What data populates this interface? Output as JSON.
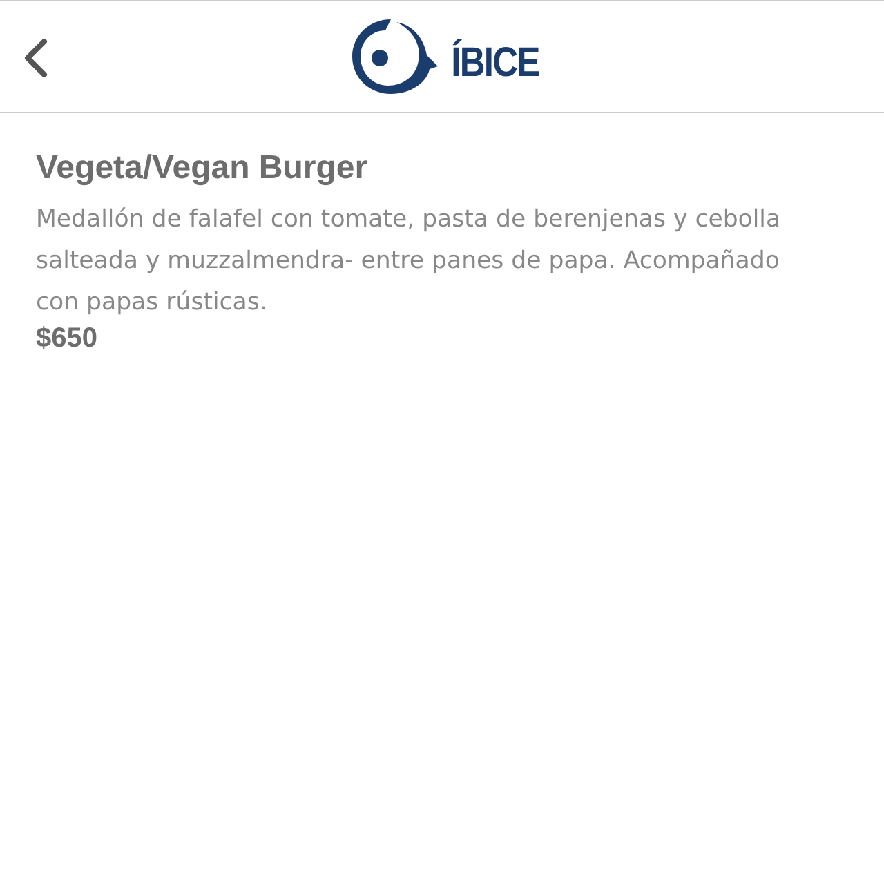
{
  "header": {
    "logo_text": "ÍBICE"
  },
  "item": {
    "title": "Vegeta/Vegan Burger",
    "description": "Medallón de falafel con tomate, pasta de berenjenas y cebolla salteada y muzzalmendra- entre panes de papa. Acompañado con papas rústicas.",
    "price": "$650"
  }
}
